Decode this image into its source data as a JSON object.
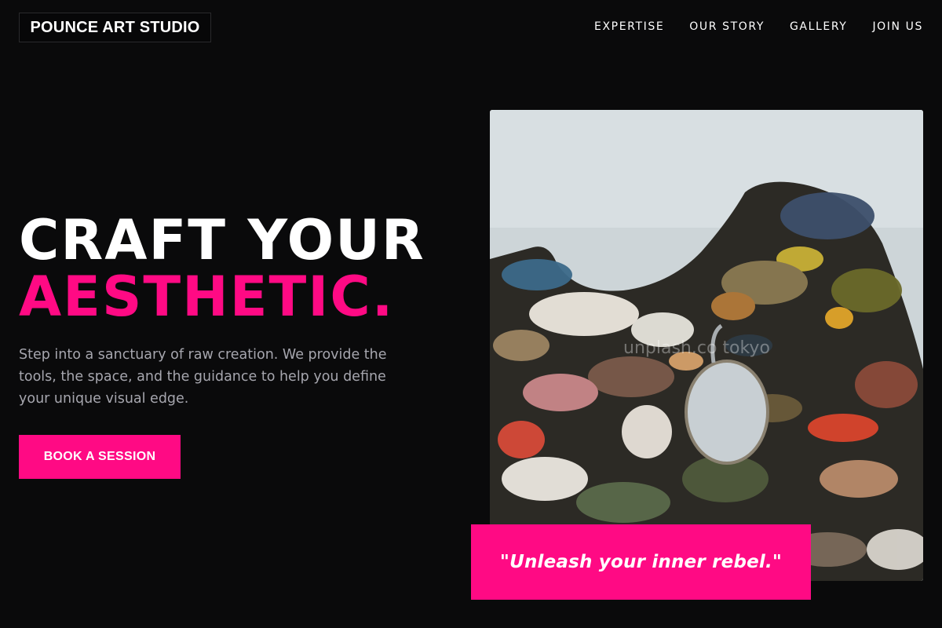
{
  "brand": {
    "name": "POUNCE ART STUDIO"
  },
  "nav": {
    "items": [
      {
        "label": "EXPERTISE"
      },
      {
        "label": "OUR STORY"
      },
      {
        "label": "GALLERY"
      },
      {
        "label": "JOIN US"
      }
    ]
  },
  "hero": {
    "headline_line1": "CRAFT YOUR",
    "headline_line2": "AESTHETIC.",
    "description": "Step into a sanctuary of raw creation. We provide the tools, the space, and the guidance to help you define your unique visual edge.",
    "cta_label": "BOOK A SESSION"
  },
  "image": {
    "alt": "Paint-covered wooden palette",
    "watermark": "unplash.co tokyo"
  },
  "quote": {
    "text": "\"Unleash your inner rebel.\""
  },
  "colors": {
    "accent": "#ff0a84",
    "background": "#0a0a0b",
    "muted_text": "#a6a6ae"
  }
}
